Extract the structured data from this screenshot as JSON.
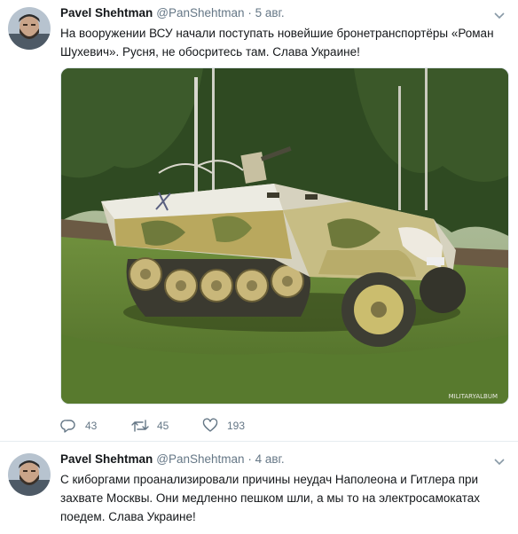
{
  "tweets": [
    {
      "author_name": "Pavel Shehtman",
      "handle": "@PanShehtman",
      "separator": "·",
      "date": "5 авг.",
      "text_line1": "На вооружении ВСУ начали поступать новейшие бронетранспортёры «Роман",
      "text_line2": "Шухевич». Русня, не обосритесь там. Слава Украине!",
      "media_watermark": "MILITARYALBUM",
      "replies": "43",
      "retweets": "45",
      "likes": "193"
    },
    {
      "author_name": "Pavel Shehtman",
      "handle": "@PanShehtman",
      "separator": "·",
      "date": "4 авг.",
      "text_line1": "С киборгами проанализировали причины неудач Наполеона и Гитлера при",
      "text_line2": "захвате Москвы. Они медленно пешком шли, а мы то на электросамокатах",
      "text_line3": "поедем. Слава Украине!"
    }
  ],
  "icons": {
    "avatar": "avatar-photo",
    "caret": "chevron-down-icon",
    "reply": "reply-icon",
    "retweet": "retweet-icon",
    "like": "heart-icon"
  },
  "colors": {
    "text": "#14171a",
    "secondary": "#657786",
    "divider": "#e6ecf0"
  }
}
